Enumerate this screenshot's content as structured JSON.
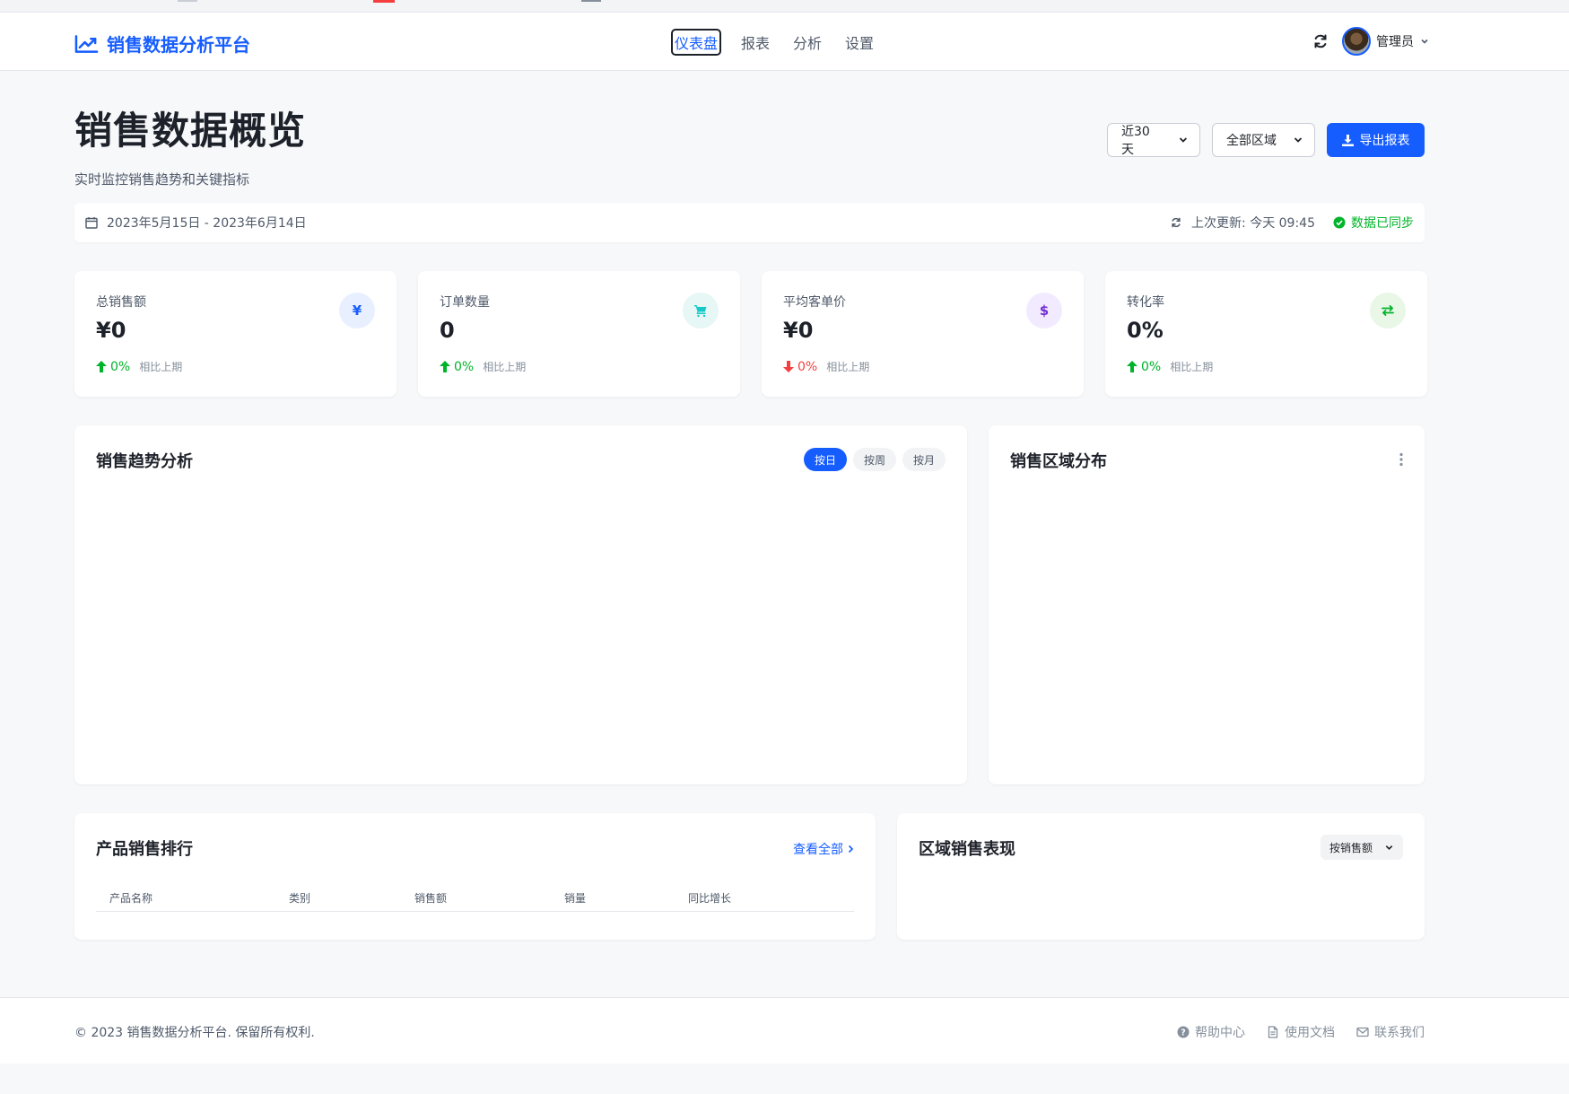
{
  "app": {
    "brand": "销售数据分析平台",
    "nav": [
      "仪表盘",
      "报表",
      "分析",
      "设置"
    ],
    "user": "管理员"
  },
  "header": {
    "title": "销售数据概览",
    "subtitle": "实时监控销售趋势和关键指标",
    "range_select": "近30天",
    "region_select": "全部区域",
    "export_label": "导出报表"
  },
  "datebar": {
    "range": "2023年5月15日 - 2023年6月14日",
    "last_update": "上次更新: 今天 09:45",
    "sync_status": "数据已同步"
  },
  "metrics": [
    {
      "label": "总销售额",
      "value": "¥0",
      "change": "0%",
      "direction": "up",
      "compare": "相比上期",
      "icon": "yen-icon",
      "glyph": "¥"
    },
    {
      "label": "订单数量",
      "value": "0",
      "change": "0%",
      "direction": "up",
      "compare": "相比上期",
      "icon": "cart-icon",
      "glyph": ""
    },
    {
      "label": "平均客单价",
      "value": "¥0",
      "change": "0%",
      "direction": "down",
      "compare": "相比上期",
      "icon": "dollar-icon",
      "glyph": "$"
    },
    {
      "label": "转化率",
      "value": "0%",
      "change": "0%",
      "direction": "up",
      "compare": "相比上期",
      "icon": "exchange-icon",
      "glyph": ""
    }
  ],
  "trend_panel": {
    "title": "销售趋势分析",
    "periods": [
      "按日",
      "按周",
      "按月"
    ],
    "active_period": "按日"
  },
  "region_panel": {
    "title": "销售区域分布"
  },
  "ranking_panel": {
    "title": "产品销售排行",
    "view_all": "查看全部",
    "columns": [
      "产品名称",
      "类别",
      "销售额",
      "销量",
      "同比增长"
    ]
  },
  "performance_panel": {
    "title": "区域销售表现",
    "sort_select": "按销售额"
  },
  "footer": {
    "copyright": "© 2023 销售数据分析平台. 保留所有权利.",
    "links": [
      "帮助中心",
      "使用文档",
      "联系我们"
    ]
  },
  "colors": {
    "primary": "#165dff",
    "success": "#00b42a",
    "danger": "#f53f3f",
    "background": "#f7f8fa"
  }
}
